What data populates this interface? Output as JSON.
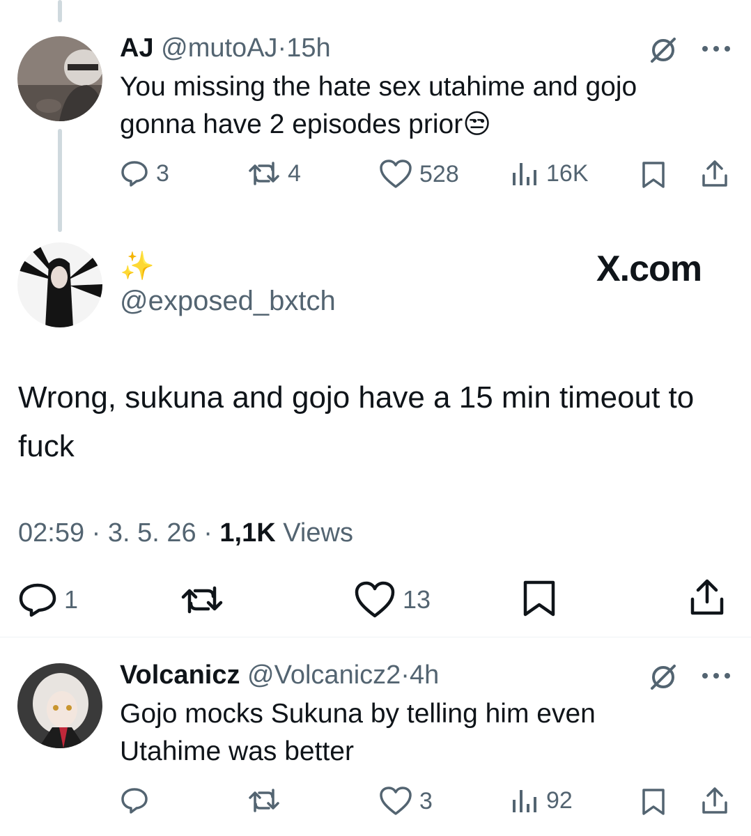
{
  "reply1": {
    "display_name": "AJ",
    "handle": "@mutoAJ",
    "time": "15h",
    "text": "You missing the hate sex utahime and gojo gonna have 2 episodes prior",
    "emoji": "😒",
    "replies": "3",
    "reposts": "4",
    "likes": "528",
    "views": "16K"
  },
  "main_post": {
    "sparkle": "✨",
    "handle": "@exposed_bxtch",
    "watermark": "X.com",
    "text": "Wrong, sukuna and gojo have a 15 min timeout to fuck",
    "time": "02:59",
    "date": "3. 5. 26",
    "views_count": "1,1K",
    "views_label": "Views",
    "replies": "1",
    "likes": "13"
  },
  "reply2": {
    "display_name": "Volcanicz",
    "handle": "@Volcanicz2",
    "time": "4h",
    "text": "Gojo mocks Sukuna by telling him even Utahime was better",
    "likes": "3",
    "views": "92"
  },
  "separator": "·",
  "colors": {
    "text_primary": "#0f1419",
    "text_secondary": "#536471",
    "thread_line": "#cfd9de",
    "divider": "#eff3f4"
  },
  "icons": [
    "grok-icon",
    "more-icon",
    "reply-icon",
    "repost-icon",
    "like-icon",
    "views-icon",
    "bookmark-icon",
    "share-icon",
    "sparkles-emoji",
    "unamused-emoji"
  ]
}
